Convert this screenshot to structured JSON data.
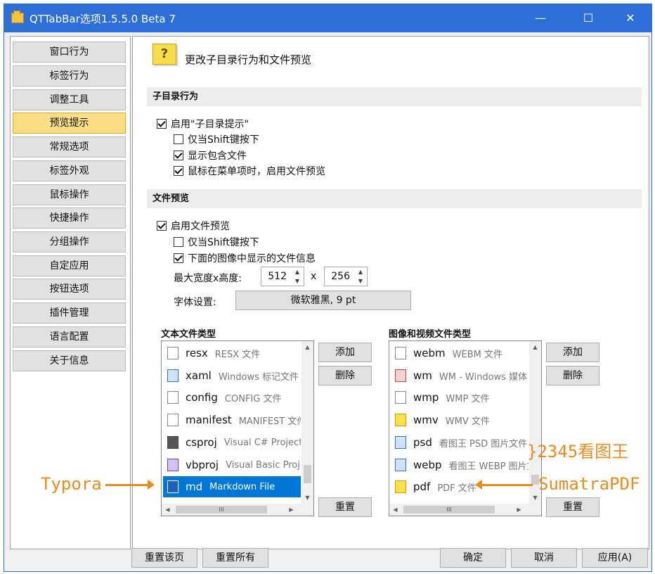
{
  "window": {
    "title": "QTTabBar选项1.5.5.0 Beta 7",
    "min": "—",
    "max": "☐",
    "close": "✕"
  },
  "sidebar": {
    "items": [
      "窗口行为",
      "标签行为",
      "调整工具",
      "预览提示",
      "常规选项",
      "标签外观",
      "鼠标操作",
      "快捷操作",
      "分组操作",
      "自定应用",
      "按钮选项",
      "插件管理",
      "语言配置",
      "关于信息"
    ],
    "active_index": 3
  },
  "page": {
    "icon": "question-icon",
    "icon_glyph": "?",
    "title": "更改子目录行为和文件预览"
  },
  "subdir": {
    "header": "子目录行为",
    "enable": {
      "label": "启用\"子目录提示\"",
      "checked": true
    },
    "shift_only": {
      "label": "仅当Shift键按下",
      "checked": false
    },
    "show_files": {
      "label": "显示包含文件",
      "checked": true
    },
    "menu_preview": {
      "label": "鼠标在菜单项时，启用文件预览",
      "checked": true
    }
  },
  "preview": {
    "header": "文件预览",
    "enable": {
      "label": "启用文件预览",
      "checked": true
    },
    "shift_only": {
      "label": "仅当Shift键按下",
      "checked": false
    },
    "show_info": {
      "label": "下面的图像中显示的文件信息",
      "checked": true
    },
    "size_label": "最大宽度x高度:",
    "width": "512",
    "x": "x",
    "height": "256",
    "font_label": "字体设置:",
    "font_value": "微软雅黑, 9 pt"
  },
  "text_types": {
    "header": "文本文件类型",
    "items": [
      {
        "ext": "resx",
        "desc": "RESX 文件",
        "icon": "file-icon"
      },
      {
        "ext": "xaml",
        "desc": "Windows 标记文件",
        "icon": "xaml-icon"
      },
      {
        "ext": "config",
        "desc": "CONFIG 文件",
        "icon": "file-icon"
      },
      {
        "ext": "manifest",
        "desc": "MANIFEST 文件",
        "icon": "file-icon"
      },
      {
        "ext": "csproj",
        "desc": "Visual C# Project f",
        "icon": "csproj-icon"
      },
      {
        "ext": "vbproj",
        "desc": "Visual Basic Proje",
        "icon": "vbproj-icon"
      },
      {
        "ext": "md",
        "desc": "Markdown File",
        "icon": "markdown-icon",
        "selected": true
      }
    ],
    "add": "添加",
    "delete": "删除",
    "reset": "重置"
  },
  "media_types": {
    "header": "图像和视频文件类型",
    "items": [
      {
        "ext": "webm",
        "desc": "WEBM 文件",
        "icon": "file-icon"
      },
      {
        "ext": "wm",
        "desc": "WM - Windows 媒体",
        "icon": "media-icon"
      },
      {
        "ext": "wmp",
        "desc": "WMP 文件",
        "icon": "file-icon"
      },
      {
        "ext": "wmv",
        "desc": "WMV 文件",
        "icon": "video-icon"
      },
      {
        "ext": "psd",
        "desc": "看图王 PSD 图片文件",
        "icon": "image-icon"
      },
      {
        "ext": "webp",
        "desc": "看图王 WEBP 图片文",
        "icon": "image-icon"
      },
      {
        "ext": "pdf",
        "desc": "PDF 文件",
        "icon": "pdf-icon"
      }
    ],
    "add": "添加",
    "delete": "删除",
    "reset": "重置"
  },
  "annotations": {
    "typora": "Typora",
    "viewer": "}2345看图王",
    "sumatra": "SumatraPDF"
  },
  "footer": {
    "reset_page": "重置该页",
    "reset_all": "重置所有",
    "ok": "确定",
    "cancel": "取消",
    "apply": "应用(A)"
  },
  "scroll": {
    "hthumb": "III",
    "up": "▲",
    "down": "▼",
    "left": "◀",
    "right": "▶"
  },
  "colors": {
    "titlebar": "#2d6fd7",
    "active_sidebar": "#fbdd84",
    "selection": "#0078d7",
    "annotation": "#ec8a1c"
  }
}
